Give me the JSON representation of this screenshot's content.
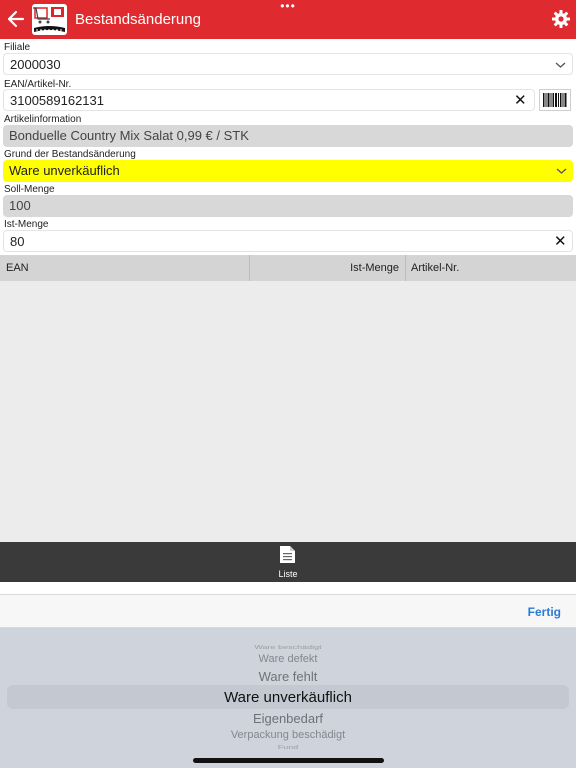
{
  "header": {
    "dots": "•••",
    "title": "Bestandsänderung",
    "back_icon": "back-arrow-icon",
    "settings_icon": "gear-icon",
    "logo_icon": "shopping-cart-logo-icon",
    "color": "#df2b2f"
  },
  "form": {
    "filiale": {
      "label": "Filiale",
      "value": "2000030"
    },
    "ean": {
      "label": "EAN/Artikel-Nr.",
      "value": "3100589162131",
      "clear": "✕"
    },
    "artikelinfo": {
      "label": "Artikelinformation",
      "value": "Bonduelle Country Mix Salat 0,99 € / STK"
    },
    "grund": {
      "label": "Grund der Bestandsänderung",
      "value": "Ware unverkäuflich"
    },
    "soll": {
      "label": "Soll-Menge",
      "value": "100"
    },
    "ist": {
      "label": "Ist-Menge",
      "value": "80",
      "clear": "✕"
    }
  },
  "table": {
    "columns": [
      "EAN",
      "Ist-Menge",
      "Artikel-Nr."
    ]
  },
  "tabbar": {
    "icon": "list-document-icon",
    "label": "Liste"
  },
  "picker": {
    "done_label": "Fertig",
    "options": [
      "Ware beschädigt",
      "Ware defekt",
      "Ware fehlt",
      "Ware unverkäuflich",
      "Eigenbedarf",
      "Verpackung beschädigt",
      "Fund"
    ],
    "selected": "Ware unverkäuflich"
  }
}
